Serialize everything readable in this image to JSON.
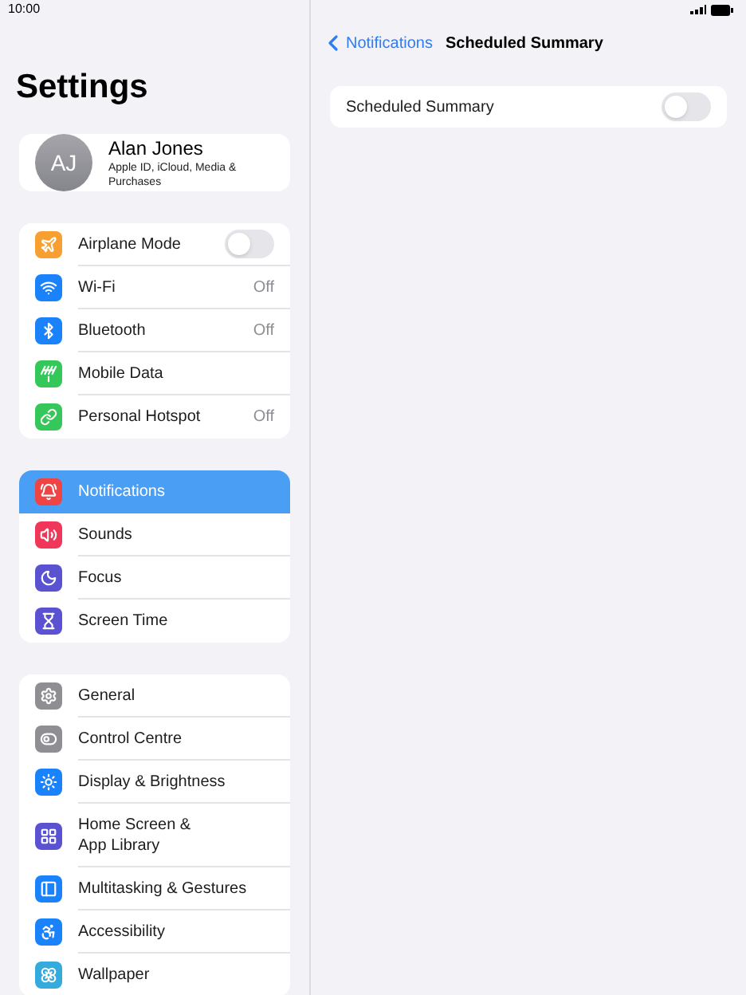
{
  "status_bar": {
    "time": "10:00"
  },
  "sidebar": {
    "title": "Settings",
    "profile": {
      "initials": "AJ",
      "name": "Alan Jones",
      "subtitle": "Apple ID, iCloud, Media & Purchases"
    },
    "groups": [
      {
        "items": [
          {
            "label": "Airplane Mode",
            "kind": "toggle",
            "on": false,
            "color": "#f7a031",
            "selected": false
          },
          {
            "label": "Wi-Fi",
            "kind": "value",
            "value": "Off",
            "color": "#1a82fb",
            "selected": false
          },
          {
            "label": "Bluetooth",
            "kind": "value",
            "value": "Off",
            "color": "#1a82fb",
            "selected": false
          },
          {
            "label": "Mobile Data",
            "kind": "plain",
            "color": "#35c759",
            "selected": false
          },
          {
            "label": "Personal Hotspot",
            "kind": "value",
            "value": "Off",
            "color": "#35c759",
            "selected": false
          }
        ]
      },
      {
        "items": [
          {
            "label": "Notifications",
            "kind": "plain",
            "color": "#ee4444",
            "selected": true
          },
          {
            "label": "Sounds",
            "kind": "plain",
            "color": "#f0375a",
            "selected": false
          },
          {
            "label": "Focus",
            "kind": "plain",
            "color": "#5a52d0",
            "selected": false
          },
          {
            "label": "Screen Time",
            "kind": "plain",
            "color": "#5a52d0",
            "selected": false
          }
        ]
      },
      {
        "items": [
          {
            "label": "General",
            "kind": "plain",
            "color": "#8e8e93",
            "selected": false
          },
          {
            "label": "Control Centre",
            "kind": "plain",
            "color": "#8e8e93",
            "selected": false
          },
          {
            "label": "Display & Brightness",
            "kind": "plain",
            "color": "#1a82fb",
            "selected": false
          },
          {
            "label": "Home Screen & App Library",
            "kind": "plain",
            "color": "#5a52d0",
            "selected": false
          },
          {
            "label": "Multitasking & Gestures",
            "kind": "plain",
            "color": "#1a82fb",
            "selected": false
          },
          {
            "label": "Accessibility",
            "kind": "plain",
            "color": "#1a82fb",
            "selected": false
          },
          {
            "label": "Wallpaper",
            "kind": "plain",
            "color": "#35aadc",
            "selected": false
          }
        ]
      }
    ]
  },
  "detail": {
    "back": "Notifications",
    "title": "Scheduled Summary",
    "rows": [
      {
        "label": "Scheduled Summary",
        "kind": "toggle",
        "on": false
      }
    ]
  }
}
